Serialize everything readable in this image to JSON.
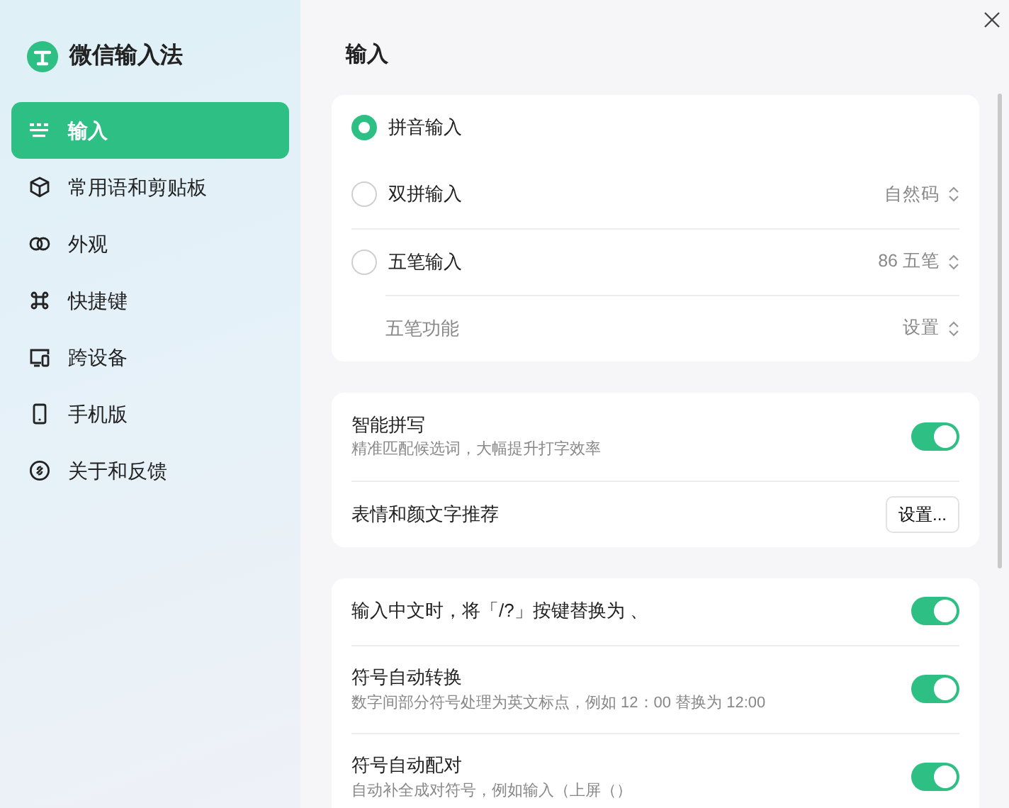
{
  "app": {
    "title": "微信输入法"
  },
  "sidebar": {
    "items": [
      {
        "label": "输入",
        "selected": true
      },
      {
        "label": "常用语和剪贴板",
        "selected": false
      },
      {
        "label": "外观",
        "selected": false
      },
      {
        "label": "快捷键",
        "selected": false
      },
      {
        "label": "跨设备",
        "selected": false
      },
      {
        "label": "手机版",
        "selected": false
      },
      {
        "label": "关于和反馈",
        "selected": false
      }
    ]
  },
  "page_title": "输入",
  "input_methods": [
    {
      "label": "拼音输入",
      "selected": true
    },
    {
      "label": "双拼输入",
      "selected": false,
      "option": "自然码"
    },
    {
      "label": "五笔输入",
      "selected": false,
      "option": "86 五笔"
    }
  ],
  "wubi_feature": {
    "label": "五笔功能",
    "option": "设置"
  },
  "smart_settings": [
    {
      "kind": "toggle",
      "label": "智能拼写",
      "description": "精准匹配候选词，大幅提升打字效率",
      "on": true
    },
    {
      "kind": "button",
      "label": "表情和颜文字推荐",
      "button": "设置..."
    }
  ],
  "punctuation_settings": [
    {
      "kind": "toggle",
      "label": "输入中文时，将「/?」按键替换为 、",
      "on": true
    },
    {
      "kind": "toggle",
      "label": "符号自动转换",
      "description": "数字间部分符号处理为英文标点，例如 12：00 替换为 12:00",
      "on": true
    },
    {
      "kind": "toggle",
      "label": "符号自动配对",
      "description": "自动补全成对符号，例如输入（上屏（）",
      "on": true
    }
  ]
}
